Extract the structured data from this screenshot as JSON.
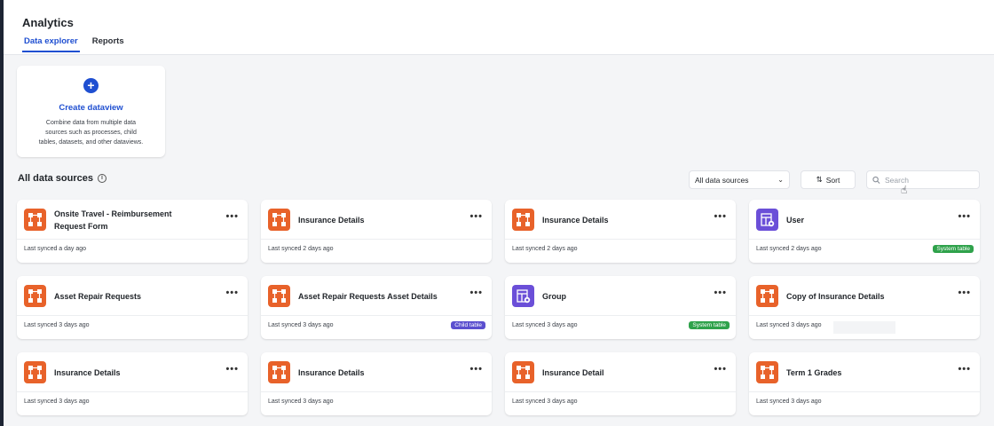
{
  "page": {
    "title": "Analytics"
  },
  "tabs": [
    {
      "label": "Data explorer",
      "active": true
    },
    {
      "label": "Reports",
      "active": false
    }
  ],
  "create_card": {
    "icon": "plus-icon",
    "title": "Create dataview",
    "description": "Combine data from multiple data sources such as processes, child tables, datasets, and other dataviews."
  },
  "section": {
    "title": "All data sources",
    "info_icon": "info-icon"
  },
  "toolbar": {
    "filter_value": "All data sources",
    "sort_label": "Sort",
    "search_placeholder": "Search"
  },
  "colors": {
    "accent": "#1f4fd1",
    "process_icon": "#e8622a",
    "system_icon": "#6b4fd8",
    "system_badge": "#2fa24b",
    "child_badge": "#5b4fcf"
  },
  "cards": [
    {
      "title": "Onsite Travel - Reimbursement Request Form",
      "sync": "Last synced a day ago",
      "icon": "process",
      "badge": ""
    },
    {
      "title": "Insurance Details",
      "sync": "Last synced 2 days ago",
      "icon": "process",
      "badge": ""
    },
    {
      "title": "Insurance Details",
      "sync": "Last synced 2 days ago",
      "icon": "process",
      "badge": ""
    },
    {
      "title": "User",
      "sync": "Last synced 2 days ago",
      "icon": "user-table",
      "badge": "System table"
    },
    {
      "title": "Asset Repair Requests",
      "sync": "Last synced 3 days ago",
      "icon": "process",
      "badge": ""
    },
    {
      "title": "Asset Repair Requests Asset Details",
      "sync": "Last synced 3 days ago",
      "icon": "process",
      "badge": "Child table"
    },
    {
      "title": "Group",
      "sync": "Last synced 3 days ago",
      "icon": "group-table",
      "badge": "System table"
    },
    {
      "title": "Copy of Insurance Details",
      "sync": "Last synced 3 days ago",
      "icon": "process",
      "badge": ""
    },
    {
      "title": "Insurance Details",
      "sync": "Last synced 3 days ago",
      "icon": "process",
      "badge": ""
    },
    {
      "title": "Insurance Details",
      "sync": "Last synced 3 days ago",
      "icon": "process",
      "badge": ""
    },
    {
      "title": "Insurance Detail",
      "sync": "Last synced 3 days ago",
      "icon": "process",
      "badge": ""
    },
    {
      "title": "Term 1 Grades",
      "sync": "Last synced 3 days ago",
      "icon": "process",
      "badge": ""
    }
  ]
}
